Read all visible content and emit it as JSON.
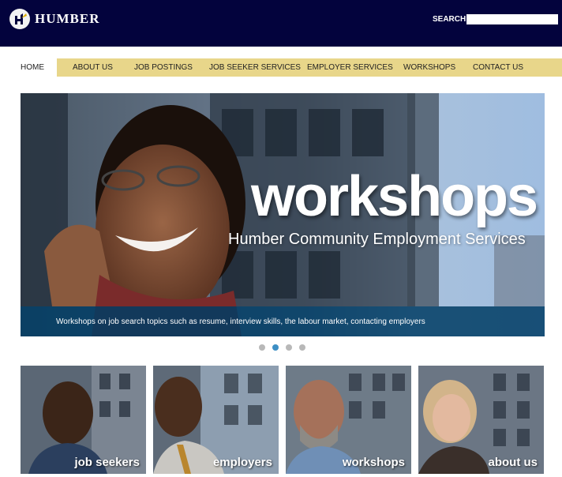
{
  "header": {
    "logo_text": "HUMBER",
    "logo_icon": "humber-logo-icon",
    "search_label": "SEARCH",
    "search_value": ""
  },
  "nav": {
    "items": [
      {
        "label": "HOME",
        "active": true
      },
      {
        "label": "ABOUT US"
      },
      {
        "label": "JOB POSTINGS"
      },
      {
        "label": "JOB SEEKER SERVICES"
      },
      {
        "label": "EMPLOYER SERVICES"
      },
      {
        "label": "WORKSHOPS"
      },
      {
        "label": "CONTACT US"
      }
    ]
  },
  "hero": {
    "title": "workshops",
    "subtitle": "Humber Community Employment Services",
    "caption": "Workshops on job search topics such as resume, interview skills, the labour market, contacting employers"
  },
  "carousel": {
    "slide_count": 4,
    "active_index": 1
  },
  "tiles": [
    {
      "label": "job seekers"
    },
    {
      "label": "employers"
    },
    {
      "label": "workshops"
    },
    {
      "label": "about us"
    }
  ],
  "colors": {
    "header_bg": "#03033d",
    "nav_bar": "#e8d68a",
    "caption_bg": "#003c64",
    "dot_active": "#3d8fc4"
  }
}
